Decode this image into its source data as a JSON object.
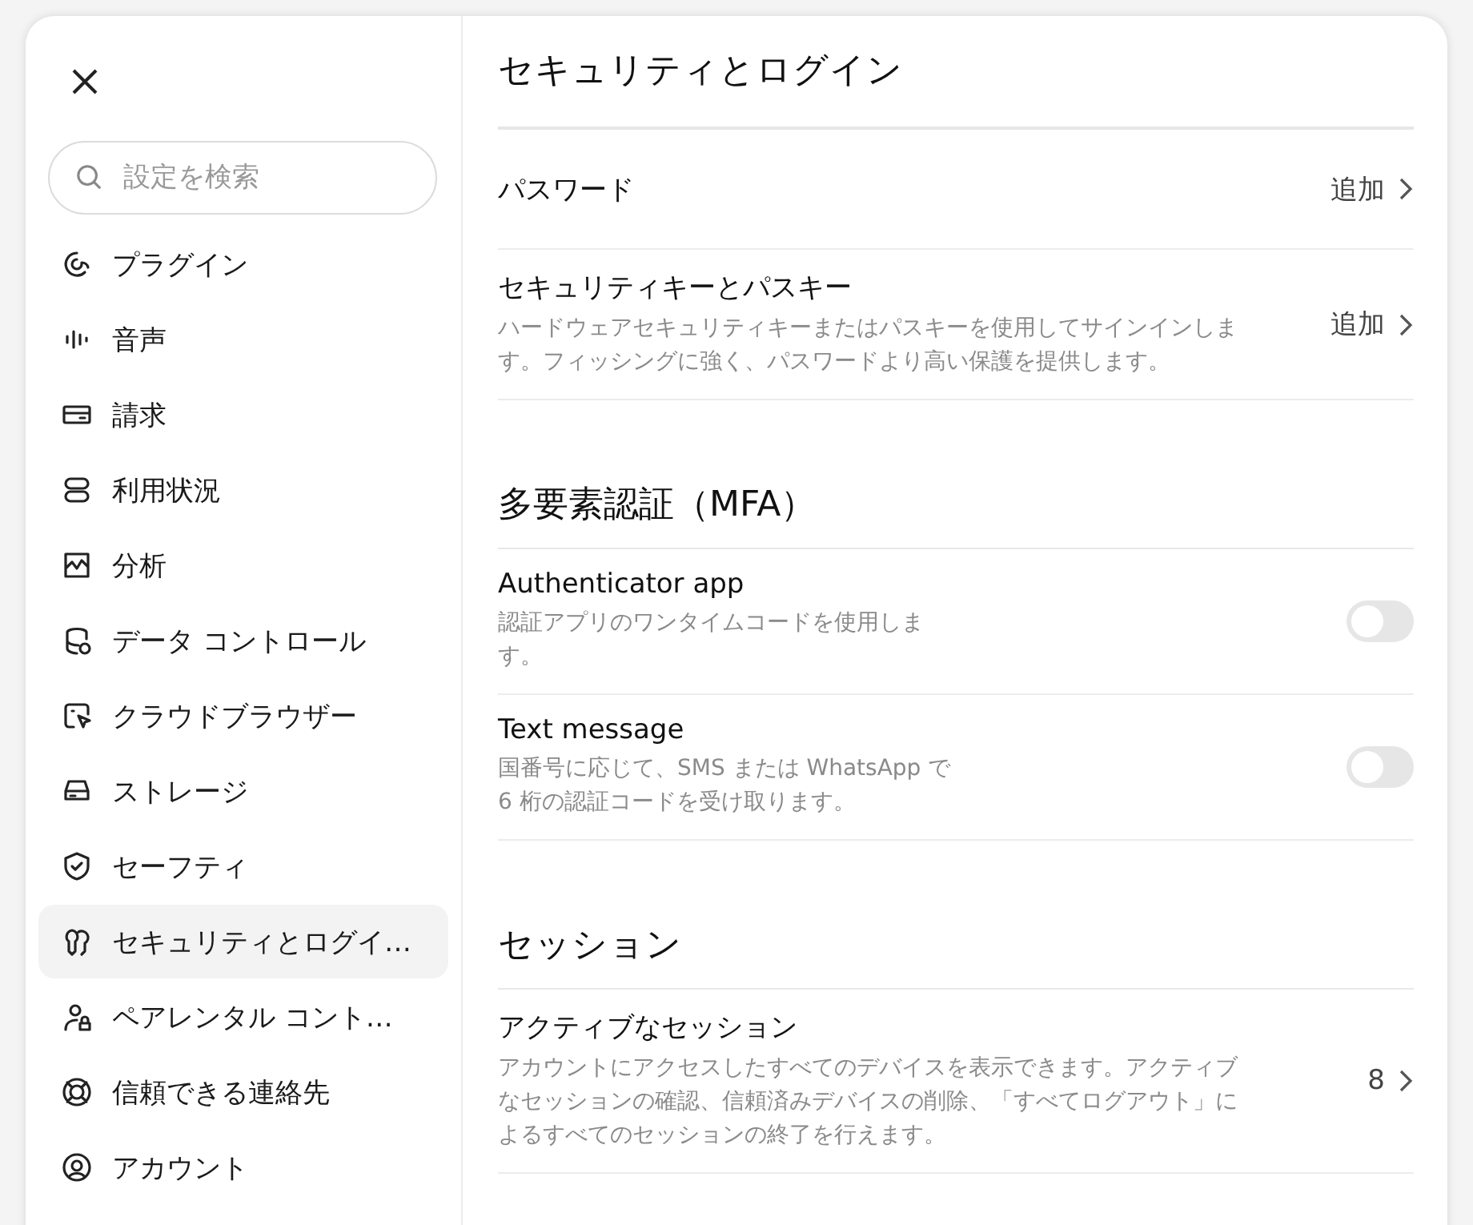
{
  "sidebar": {
    "search": {
      "placeholder": "設定を検索"
    },
    "items": [
      {
        "label": "プラグイン",
        "selected": false
      },
      {
        "label": "音声",
        "selected": false
      },
      {
        "label": "請求",
        "selected": false
      },
      {
        "label": "利用状況",
        "selected": false
      },
      {
        "label": "分析",
        "selected": false
      },
      {
        "label": "データ コントロール",
        "selected": false
      },
      {
        "label": "クラウドブラウザー",
        "selected": false
      },
      {
        "label": "ストレージ",
        "selected": false
      },
      {
        "label": "セーフティ",
        "selected": false
      },
      {
        "label": "セキュリティとログイ…",
        "selected": true
      },
      {
        "label": "ペアレンタル コント…",
        "selected": false
      },
      {
        "label": "信頼できる連絡先",
        "selected": false
      },
      {
        "label": "アカウント",
        "selected": false
      }
    ]
  },
  "sections": [
    {
      "title": "セキュリティとログイン",
      "rows": [
        {
          "kind": "link",
          "title": "パスワード",
          "value": "追加"
        },
        {
          "kind": "link",
          "title": "セキュリティキーとパスキー",
          "description": "ハードウェアセキュリティキーまたはパスキーを使用してサインインします。フィッシングに強く、パスワードより高い保護を提供します。",
          "value": "追加"
        }
      ]
    },
    {
      "title": "多要素認証（MFA）",
      "rows": [
        {
          "kind": "toggle",
          "title": "Authenticator app",
          "description": "認証アプリのワンタイムコードを使用します。",
          "on": false
        },
        {
          "kind": "toggle",
          "title": "Text message",
          "description": "国番号に応じて、SMS または WhatsApp で 6 桁の認証コードを受け取ります。",
          "on": false
        }
      ]
    },
    {
      "title": "セッション",
      "rows": [
        {
          "kind": "link",
          "title": "アクティブなセッション",
          "description": "アカウントにアクセスしたすべてのデバイスを表示できます。アクティブなセッションの確認、信頼済みデバイスの削除、「すべてログアウト」によるすべてのセッションの終了を行えます。",
          "value": "8"
        }
      ]
    }
  ]
}
